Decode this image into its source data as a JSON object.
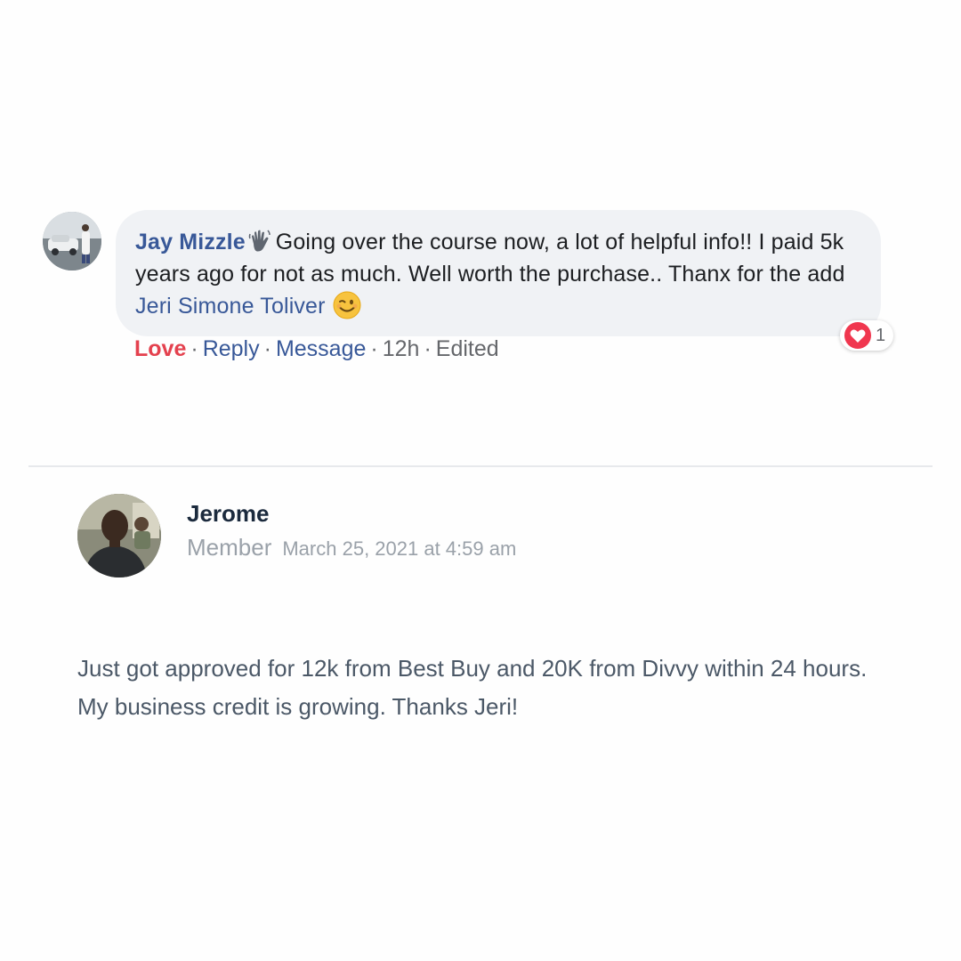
{
  "comment": {
    "author": "Jay Mizzle",
    "text_part1": "Going over the course now, a lot of helpful info!! I paid 5k years ago for not as much. Well worth the purchase.. Thanx for the add",
    "mention": "Jeri Simone Toliver",
    "badge_icon": "waving-hand-icon",
    "emoji_icon": "winking-face-icon",
    "reaction": {
      "icon": "heart-icon",
      "count": "1",
      "color": "#e4414e"
    },
    "actions": {
      "love": "Love",
      "reply": "Reply",
      "message": "Message",
      "time": "12h",
      "edited": "Edited",
      "separator": "·"
    },
    "colors": {
      "link": "#385898",
      "love": "#e4414e",
      "bubble": "#f0f2f5"
    }
  },
  "post": {
    "author": "Jerome",
    "role": "Member",
    "date": "March 25, 2021 at 4:59 am",
    "body": "Just got approved for 12k from Best Buy and 20K from Divvy within 24 hours. My business credit is growing. Thanks Jeri!"
  }
}
